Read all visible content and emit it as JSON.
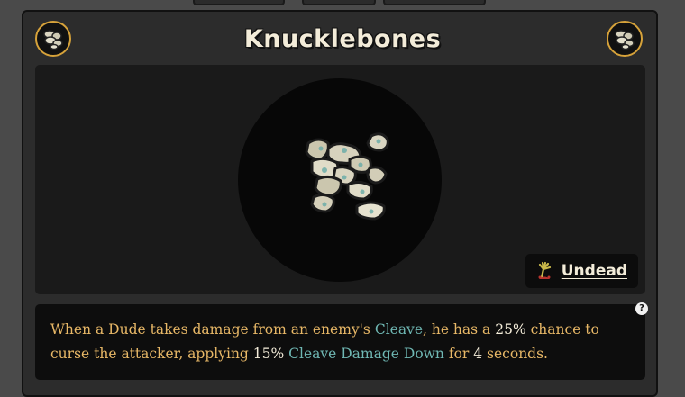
{
  "item": {
    "title": "Knucklebones",
    "type_label": "Undead",
    "icons": {
      "item": "knucklebones-icon",
      "type": "undead-hand-icon",
      "help": "question-mark-icon"
    }
  },
  "help_label": "?",
  "description": {
    "t1": "When a Dude takes damage from an enemy's ",
    "k1": "Cleave",
    "t2": ", he has a ",
    "n1": "25%",
    "t3": " chance to curse the attacker, applying ",
    "n2": "15%",
    "t4": " ",
    "k2": "Cleave Damage Down",
    "t5": " for ",
    "n3": "4",
    "t6": " seconds."
  },
  "colors": {
    "accent_gold": "#d6a23a",
    "text_gold": "#e8b867",
    "keyword_teal": "#6fb7b3",
    "title_cream": "#f3ecd9"
  }
}
